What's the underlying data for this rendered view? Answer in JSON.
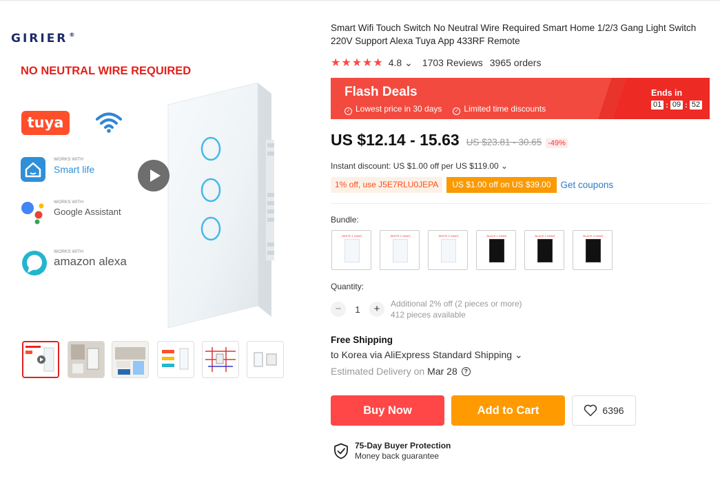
{
  "gallery": {
    "brand": "GIRIER",
    "brand_mark": "®",
    "headline": "NO NEUTRAL WIRE REQUIRED",
    "tuya_logo": "tuya",
    "services": [
      {
        "small": "WORKS WITH",
        "name": "Smart life",
        "icon": "house-icon"
      },
      {
        "small": "WORKS WITH",
        "name": "Google Assistant",
        "icon": "google-assistant-icon"
      },
      {
        "small": "WORKS WITH",
        "name": "amazon alexa",
        "icon": "alexa-icon"
      }
    ],
    "thumbnail_count": 6,
    "active_thumbnail": 1
  },
  "product": {
    "title": "Smart Wifi Touch Switch No Neutral Wire Required Smart Home 1/2/3 Gang Light Switch 220V Support Alexa Tuya App 433RF Remote",
    "stars": "★★★★★",
    "rating": "4.8",
    "rating_chevron": "⌄",
    "reviews": "1703 Reviews",
    "orders": "3965 orders"
  },
  "flash": {
    "title": "Flash Deals",
    "perk1": "Lowest price in 30 days",
    "perk2": "Limited time discounts",
    "ends_label": "Ends in",
    "hours": "01",
    "minutes": "09",
    "seconds": "52",
    "colors": {
      "bg": "#f34a3f",
      "stripe": "#ee2a25"
    }
  },
  "price": {
    "current": "US $12.14 - 15.63",
    "original": "US $23.81 - 30.65",
    "discount": "-49%"
  },
  "instant_discount": "Instant discount: US $1.00 off per US $119.00 ⌄",
  "coupons": {
    "code": "1% off, use J5E7RLU0JEPA",
    "offer": "US $1.00 off on US $39.00",
    "get_link": "Get coupons"
  },
  "bundle": {
    "label": "Bundle:",
    "items": [
      {
        "color": "white",
        "caption": "WHITE 1 GANG"
      },
      {
        "color": "white",
        "caption": "WHITE 2 GANG"
      },
      {
        "color": "white",
        "caption": "WHITE 3 GANG"
      },
      {
        "color": "black",
        "caption": "BLACK 1 GANG"
      },
      {
        "color": "black",
        "caption": "BLACK 2 GANG"
      },
      {
        "color": "black",
        "caption": "BLACK 3 GANG"
      }
    ]
  },
  "quantity": {
    "label": "Quantity:",
    "minus": "−",
    "value": "1",
    "plus": "+",
    "note": "Additional 2% off (2 pieces or more)",
    "available": "412 pieces available"
  },
  "shipping": {
    "title": "Free Shipping",
    "via": "to Korea via AliExpress Standard Shipping ⌄",
    "delivery_label": "Estimated Delivery on",
    "delivery_date": "Mar 28",
    "help": "?"
  },
  "actions": {
    "buy": "Buy Now",
    "cart": "Add to Cart",
    "wishlist_count": "6396"
  },
  "protection": {
    "title": "75-Day Buyer Protection",
    "subtitle": "Money back guarantee"
  }
}
